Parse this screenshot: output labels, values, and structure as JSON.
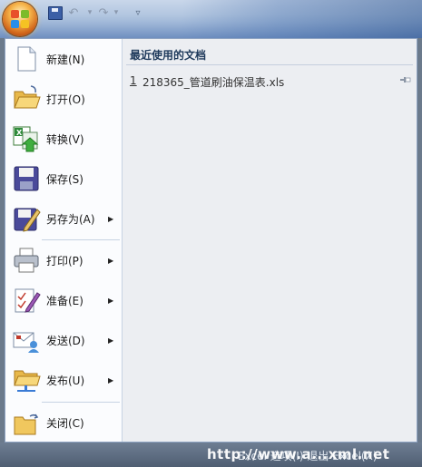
{
  "menu": {
    "items": [
      {
        "label": "新建(N)",
        "icon": "new-document-icon",
        "has_submenu": false
      },
      {
        "label": "打开(O)",
        "icon": "open-folder-icon",
        "has_submenu": false
      },
      {
        "label": "转换(V)",
        "icon": "convert-icon",
        "has_submenu": false
      },
      {
        "label": "保存(S)",
        "icon": "save-disk-icon",
        "has_submenu": false
      },
      {
        "label": "另存为(A)",
        "icon": "save-as-icon",
        "has_submenu": true
      },
      {
        "label": "打印(P)",
        "icon": "printer-icon",
        "has_submenu": true
      },
      {
        "label": "准备(E)",
        "icon": "prepare-icon",
        "has_submenu": true
      },
      {
        "label": "发送(D)",
        "icon": "send-icon",
        "has_submenu": true
      },
      {
        "label": "发布(U)",
        "icon": "publish-icon",
        "has_submenu": true
      },
      {
        "label": "关闭(C)",
        "icon": "close-folder-icon",
        "has_submenu": false
      }
    ],
    "submenu_arrow": "▶"
  },
  "recent": {
    "title": "最近使用的文档",
    "files": [
      {
        "number": "1",
        "name": "218365_管道刷油保温表.xls"
      }
    ]
  },
  "quick_access": {
    "undo_glyph": "↶",
    "redo_glyph": "↷",
    "dropdown_glyph": "▾",
    "customize_glyph": "▿"
  },
  "bottom_text": "Excel 选项(I)    退出 Excel(X)",
  "watermark": "http://www.a...xml.net",
  "colors": {
    "office_orb": "#e07a1f",
    "accent": "#1e395b"
  }
}
